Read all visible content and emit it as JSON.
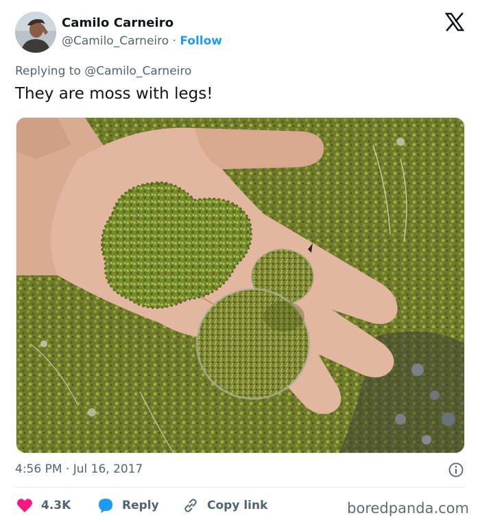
{
  "author": {
    "display_name": "Camilo Carneiro",
    "handle": "@Camilo_Carneiro",
    "separator": "·",
    "follow_label": "Follow"
  },
  "platform_icon": "x-logo-icon",
  "reply_context": {
    "prefix": "Replying to",
    "mention": "@Camilo_Carneiro"
  },
  "tweet": {
    "text": "They are moss with legs!",
    "media_icon": "photo-moss-bird-chicks-in-hand"
  },
  "meta": {
    "timestamp": "4:56 PM · Jul 16, 2017",
    "info_icon": "info-icon"
  },
  "actions": {
    "likes": "4.3K",
    "reply_label": "Reply",
    "copy_link_label": "Copy link"
  },
  "watermark": "boredpanda.com",
  "colors": {
    "like_red": "#f91880",
    "reply_blue": "#1d9bf0",
    "follow_blue": "#1d9bf0",
    "text_primary": "#0f1419",
    "text_secondary": "#536471"
  }
}
